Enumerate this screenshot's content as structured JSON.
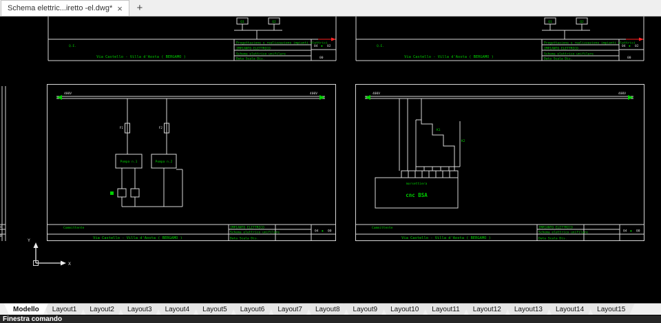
{
  "file_tabs": {
    "tabs": [
      {
        "title": "Schema elettric...iretto -el.dwg*",
        "close": "×"
      }
    ],
    "new_tab": "+"
  },
  "layout_tabs": {
    "active": "Modello",
    "items": [
      "Modello",
      "Layout1",
      "Layout2",
      "Layout3",
      "Layout4",
      "Layout5",
      "Layout6",
      "Layout7",
      "Layout8",
      "Layout9",
      "Layout10",
      "Layout11",
      "Layout12",
      "Layout13",
      "Layout14",
      "Layout15"
    ]
  },
  "command_bar": {
    "text": "Finestra comando"
  },
  "colors": {
    "canvas": "#000000",
    "drawing_line": "#d8d8d8",
    "annotation_green": "#00cf00",
    "alert_red": "#ff2424",
    "ui_light": "#f0f0f0"
  },
  "titleblock": {
    "rows": [
      "Progettazione e realizzazione impianti elettrici",
      "IMPIANTO ELETTRICO",
      "Schema elettrico unifilare",
      "Data   Scala   Dis."
    ],
    "client_label": "Committente",
    "project": "Via Castello - Villa d'Aosta ( BERGAMO )",
    "sheet_current": "04",
    "sheet_next": "02",
    "sheet_total": "00",
    "diamond": "◆"
  },
  "sheet_top": {
    "q1": "Q1",
    "q2": "Q2",
    "panel": "Q.E."
  },
  "frame_shared": {
    "bus_label": "400V"
  },
  "frame_left": {
    "f1": "F1",
    "f2": "F2",
    "box1": "Pompa n.1",
    "box2": "Pompa n.2"
  },
  "frame_right": {
    "k1": "K1",
    "k2": "K2",
    "strip": "morsettiera",
    "device": "cnc BSA"
  },
  "ucs": {
    "x": "X",
    "y": "Y"
  }
}
